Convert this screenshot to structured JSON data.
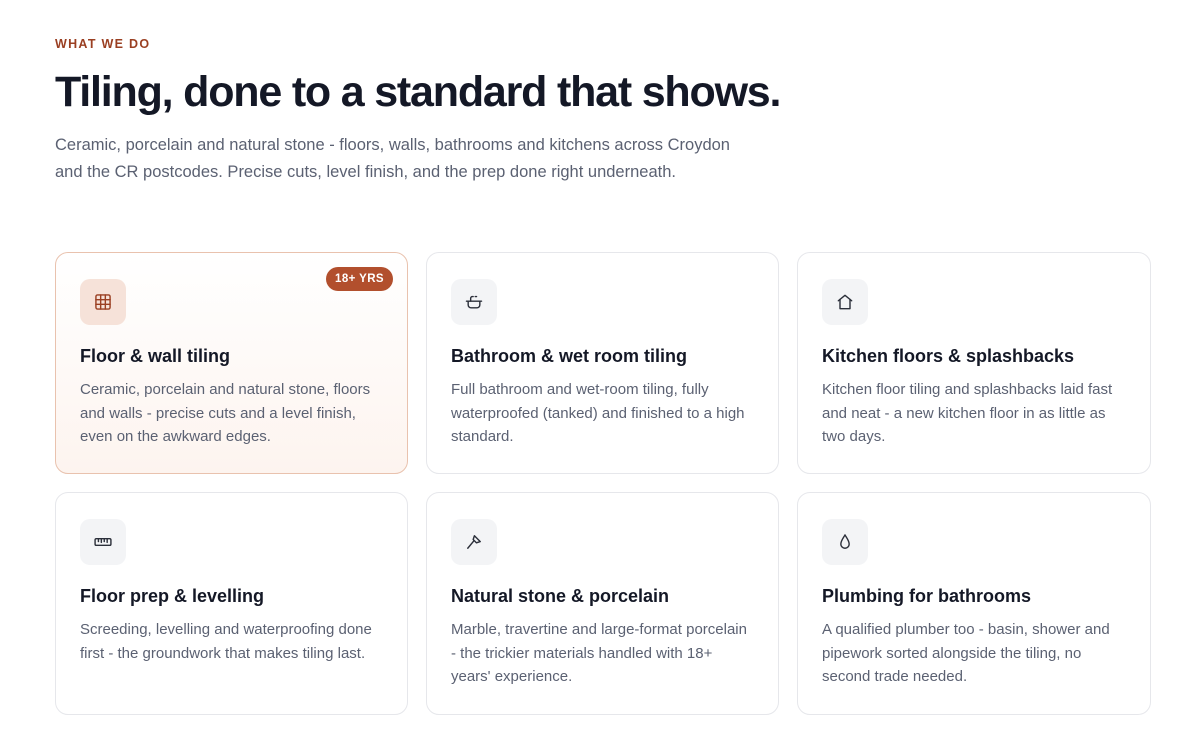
{
  "section": {
    "eyebrow": "WHAT WE DO",
    "headline": "Tiling, done to a standard that shows.",
    "intro": "Ceramic, porcelain and natural stone - floors, walls, bathrooms and kitchens across Croydon and the CR postcodes. Precise cuts, level finish, and the prep done right underneath."
  },
  "colors": {
    "accent": "#b24f2d",
    "eyebrow": "#9a3f22",
    "heading": "#141826",
    "body": "#5b6172"
  },
  "services": [
    {
      "icon": "grid-icon",
      "title": "Floor & wall tiling",
      "text": "Ceramic, porcelain and natural stone, floors and walls - precise cuts and a level finish, even on the awkward edges.",
      "badge": "18+ YRS"
    },
    {
      "icon": "bathtub-icon",
      "title": "Bathroom & wet room tiling",
      "text": "Full bathroom and wet-room tiling, fully waterproofed (tanked) and finished to a high standard."
    },
    {
      "icon": "house-icon",
      "title": "Kitchen floors & splashbacks",
      "text": "Kitchen floor tiling and splashbacks laid fast and neat - a new kitchen floor in as little as two days."
    },
    {
      "icon": "ruler-icon",
      "title": "Floor prep & levelling",
      "text": "Screeding, levelling and waterproofing done first - the groundwork that makes tiling last."
    },
    {
      "icon": "trowel-icon",
      "title": "Natural stone & porcelain",
      "text": "Marble, travertine and large-format porcelain - the trickier materials handled with 18+ years' experience."
    },
    {
      "icon": "droplet-icon",
      "title": "Plumbing for bathrooms",
      "text": "A qualified plumber too - basin, shower and pipework sorted alongside the tiling, no second trade needed."
    }
  ]
}
